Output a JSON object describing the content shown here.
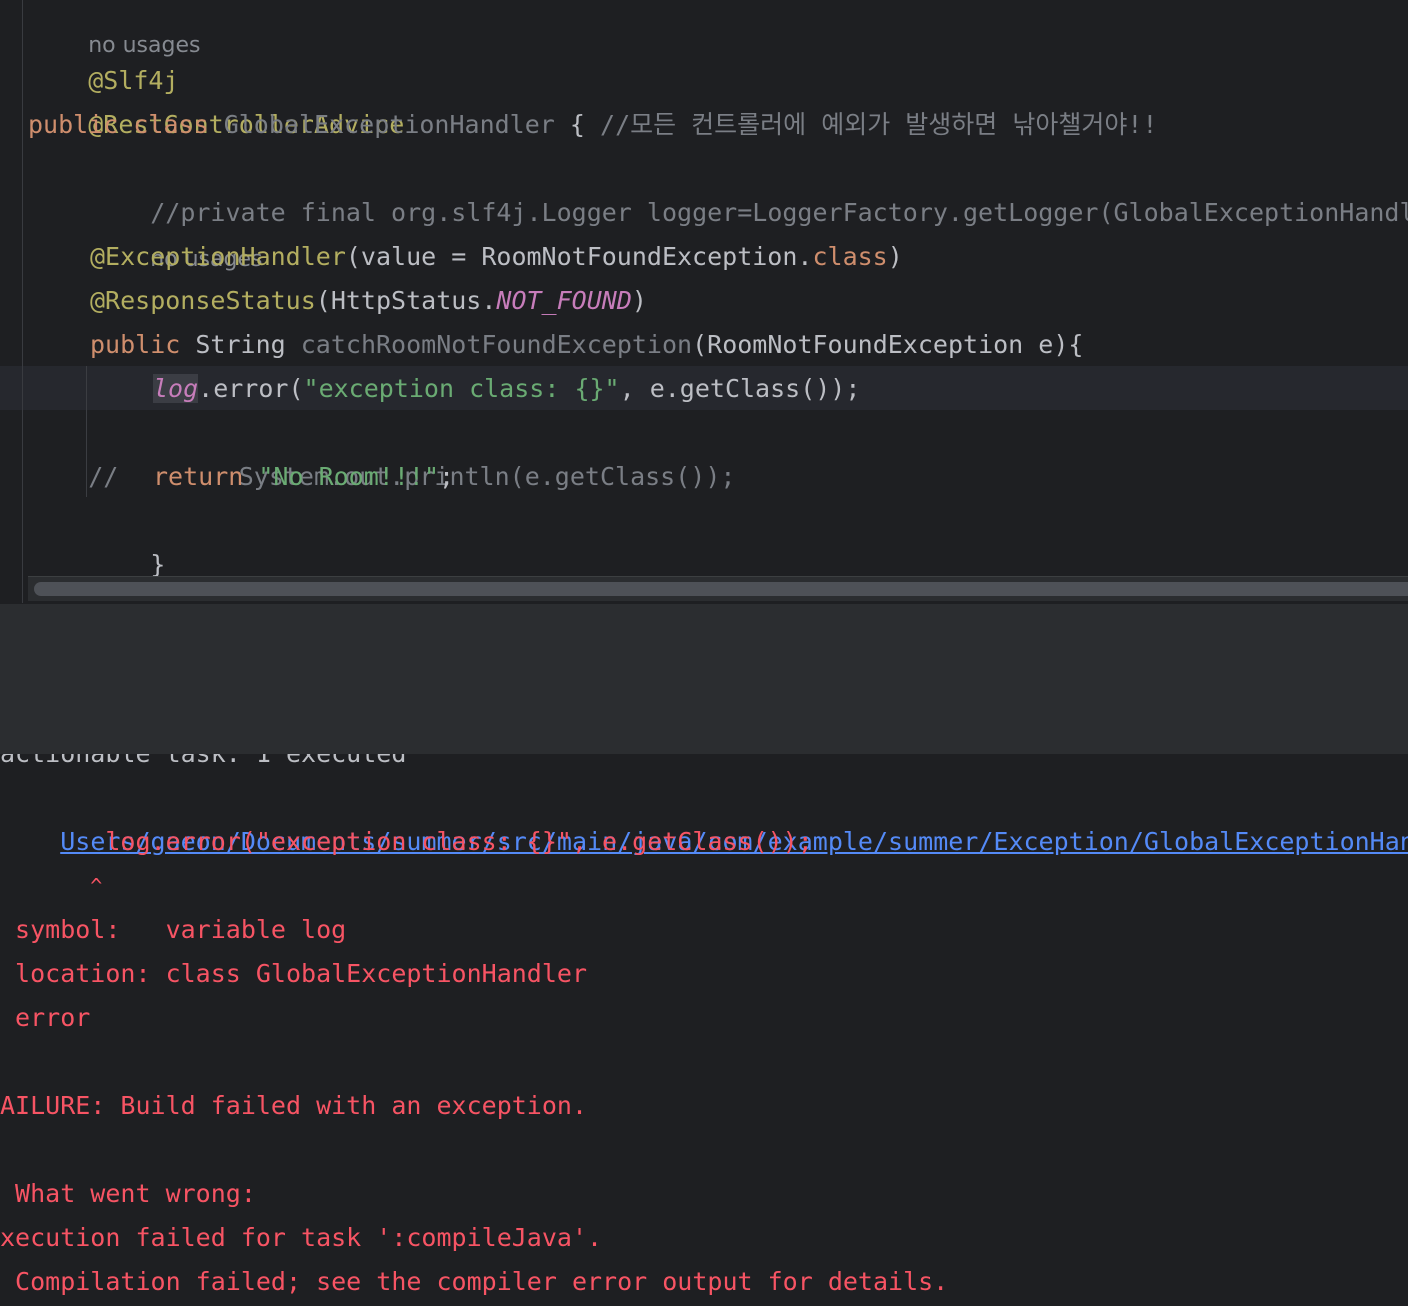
{
  "editor": {
    "lines": {
      "top_hint": "no usages",
      "l1_ann": "@Slf4j",
      "l2_ann": "@RestControllerAdvice",
      "l3_kw1": "public",
      "l3_kw2": "class",
      "l3_name": "GlobalExceptionHandler",
      "l3_brace": "{",
      "l3_comment": "//모든 컨트롤러에 예외가 발생하면 낚아챌거야!!",
      "l4_comment": "//private final org.slf4j.Logger logger=LoggerFactory.getLogger(GlobalExceptionHandle",
      "l5_hint": "no usages",
      "l6_ann": "@ExceptionHandler",
      "l6_rest1": "(value = RoomNotFoundException.",
      "l6_kw": "class",
      "l6_rest2": ")",
      "l7_ann": "@ResponseStatus",
      "l7_rest1": "(HttpStatus.",
      "l7_static": "NOT_FOUND",
      "l7_rest2": ")",
      "l8_kw": "public",
      "l8_type": "String",
      "l8_method": "catchRoomNotFoundException",
      "l8_params": "(RoomNotFoundException e){",
      "l9_log": "log",
      "l9_rest1": ".error(",
      "l9_str": "\"exception class: {}\"",
      "l9_rest2": ", e.getClass());",
      "l10_comment": "//        System.out.println(e.getClass());",
      "l11_kw": "return",
      "l11_str": "\"No Room!!!\"",
      "l11_semi": ";",
      "l12_brace": "}"
    }
  },
  "console": {
    "clipped_top": "actionable task: 1 executed",
    "path_link": "Users/gaeon/Documents/summer/src/main/java/com/example/summer/Exception/GlobalExceptionHand",
    "err_code_line": "       log.error(\"exception class: {}\", e.getClass());",
    "caret": "       ^",
    "symbol": " symbol:   variable log",
    "location": " location: class GlobalExceptionHandler",
    "error": " error",
    "failure": "AILURE: Build failed with an exception.",
    "what_went_wrong": " What went wrong:",
    "execution_failed": "xecution failed for task ':compileJava'.",
    "compilation_failed": " Compilation failed; see the compiler error output for details."
  }
}
